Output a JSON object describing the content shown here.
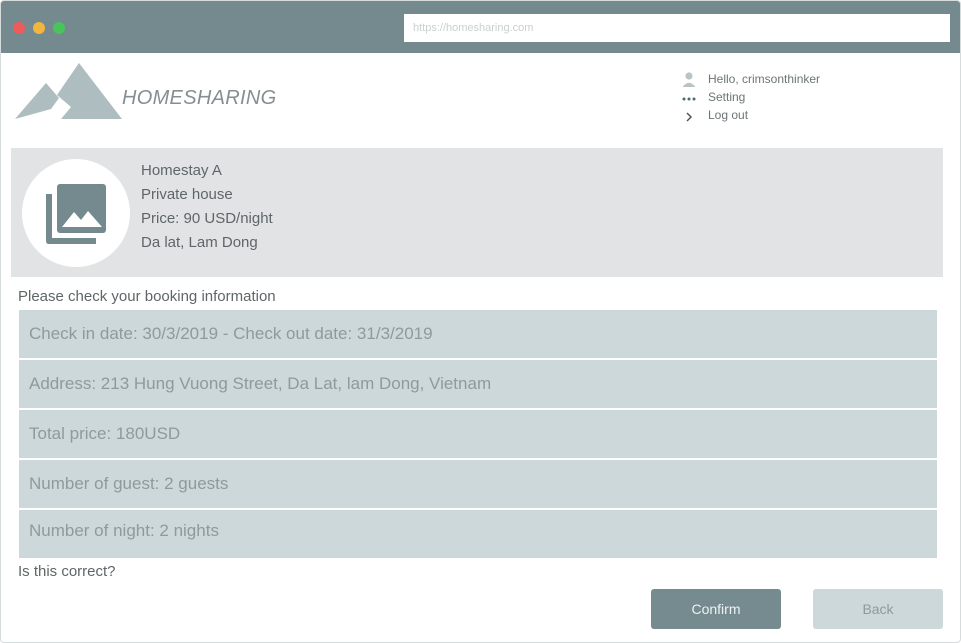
{
  "browser": {
    "url": "https://homesharing.com"
  },
  "header": {
    "brand": "HOMESHARING",
    "user_menu": [
      {
        "icon": "user-icon",
        "label": "Hello, crimsonthinker"
      },
      {
        "icon": "more-dots-icon",
        "label": "Setting"
      },
      {
        "icon": "chevron-right-icon",
        "label": "Log out"
      }
    ]
  },
  "listing": {
    "name": "Homestay A",
    "type": "Private house",
    "price": "Price: 90 USD/night",
    "location": "Da lat, Lam Dong",
    "thumbnail_icon": "photo-library-icon"
  },
  "booking": {
    "prompt": "Please check your booking information",
    "rows": [
      "Check in date: 30/3/2019 - Check out date: 31/3/2019",
      "Address: 213 Hung Vuong Street, Da Lat, lam Dong, Vietnam",
      "Total price: 180USD",
      "Number of guest: 2 guests",
      "Number of night: 2 nights"
    ],
    "question": "Is this correct?"
  },
  "actions": {
    "confirm_label": "Confirm",
    "back_label": "Back"
  },
  "colors": {
    "titlebar": "#748a8e",
    "row_bg": "#ccd8d9",
    "card_bg": "#e2e3e4",
    "confirm_bg": "#768b8f",
    "logo": "#aebdc0"
  }
}
